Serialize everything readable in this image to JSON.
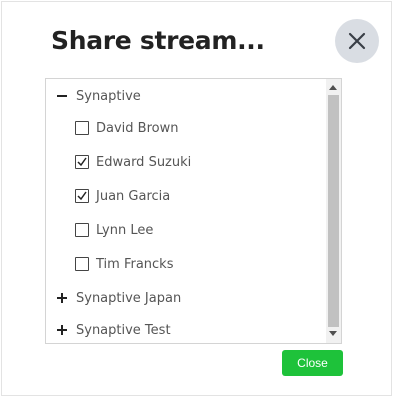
{
  "dialog": {
    "title": "Share stream...",
    "close_icon": "close-icon",
    "colors": {
      "close_button_bg": "#1ec23a",
      "close_icon_bg": "#d9dde3"
    }
  },
  "tree": {
    "groups": [
      {
        "label": "Synaptive",
        "expanded": true,
        "icon": "minus-icon",
        "members": [
          {
            "label": "David Brown",
            "checked": false
          },
          {
            "label": "Edward Suzuki",
            "checked": true
          },
          {
            "label": "Juan Garcia",
            "checked": true
          },
          {
            "label": "Lynn Lee",
            "checked": false
          },
          {
            "label": "Tim Francks",
            "checked": false
          }
        ]
      },
      {
        "label": "Synaptive Japan",
        "expanded": false,
        "icon": "plus-icon"
      },
      {
        "label": "Synaptive Test",
        "expanded": false,
        "icon": "plus-icon"
      }
    ]
  },
  "footer": {
    "close_label": "Close"
  }
}
